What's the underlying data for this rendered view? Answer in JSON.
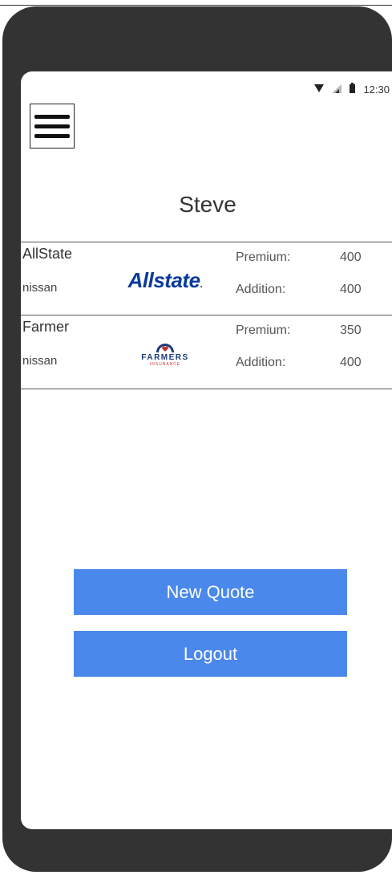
{
  "status_bar": {
    "time": "12:30",
    "icons": [
      "wifi-icon",
      "signal-icon",
      "battery-icon"
    ]
  },
  "header": {
    "menu_icon": "hamburger-menu-icon",
    "user_name": "Steve"
  },
  "quotes": [
    {
      "company": "AllState",
      "car": "nissan",
      "logo_text": "Allstate",
      "logo_suffix": ".",
      "premium_label": "Premium:",
      "premium": "400",
      "addition_label": "Addition:",
      "addition": "400"
    },
    {
      "company": "Farmer",
      "car": "nissan",
      "logo_text": "FARMERS",
      "logo_sub": "INSURANCE",
      "premium_label": "Premium:",
      "premium": "350",
      "addition_label": "Addition:",
      "addition": "400"
    }
  ],
  "actions": {
    "new_quote": "New Quote",
    "logout": "Logout"
  },
  "colors": {
    "button": "#4a88eb",
    "phone_frame": "#333333",
    "allstate_blue": "#0a3a9c",
    "farmers_blue": "#1b3a7a",
    "farmers_red": "#c52d2f"
  }
}
